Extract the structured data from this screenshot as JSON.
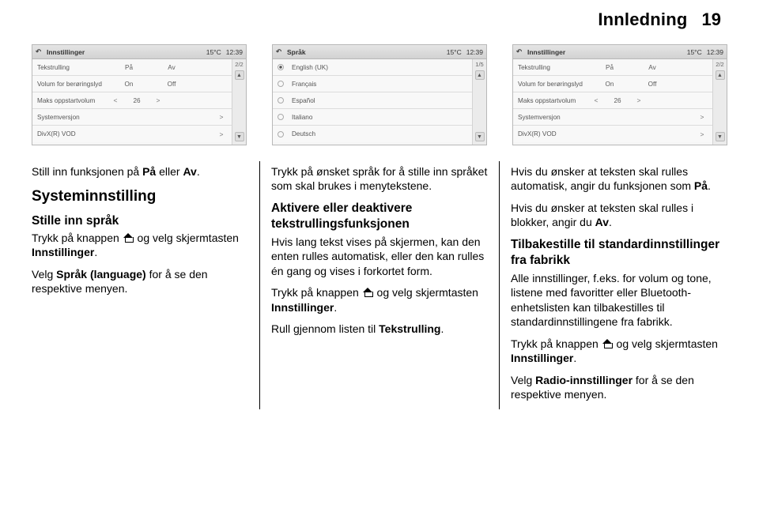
{
  "header": {
    "section": "Innledning",
    "page": "19"
  },
  "screens": {
    "settings": {
      "title": "Innstillinger",
      "temp": "15°C",
      "time": "12:39",
      "counter": "2/2",
      "rows": [
        {
          "label": "Tekstrulling",
          "opt1": "På",
          "opt2": "Av"
        },
        {
          "label": "Volum for berøringslyd",
          "opt1": "On",
          "opt2": "Off"
        },
        {
          "label": "Maks oppstartvolum",
          "left": "<",
          "val": "26",
          "right": ">"
        },
        {
          "label": "Systemversjon",
          "arrow": ">"
        },
        {
          "label": "DivX(R) VOD",
          "arrow": ">"
        }
      ]
    },
    "lang": {
      "title": "Språk",
      "temp": "15°C",
      "time": "12:39",
      "counter": "1/5",
      "rows": [
        {
          "label": "English (UK)",
          "selected": true
        },
        {
          "label": "Français"
        },
        {
          "label": "Español"
        },
        {
          "label": "Italiano"
        },
        {
          "label": "Deutsch"
        }
      ]
    }
  },
  "col1": {
    "p1a": "Still inn funksjonen på ",
    "p1b": "På",
    "p1c": " eller ",
    "p1d": "Av",
    "h1": "Systeminnstilling",
    "h2": "Stille inn språk",
    "p2a": "Trykk på knappen ",
    "p2b": " og velg skjermtasten ",
    "p2c": "Innstillinger",
    "p3a": "Velg ",
    "p3b": "Språk (language)",
    "p3c": " for å se den respektive menyen."
  },
  "col2": {
    "p1": "Trykk på ønsket språk for å stille inn språket som skal brukes i menytekstene.",
    "h2": "Aktivere eller deaktivere tekstrullingsfunksjonen",
    "p2": "Hvis lang tekst vises på skjermen, kan den enten rulles automatisk, eller den kan rulles én gang og vises i forkortet form.",
    "p3a": "Trykk på knappen ",
    "p3b": " og velg skjermtasten ",
    "p3c": "Innstillinger",
    "p4a": "Rull gjennom listen til ",
    "p4b": "Tekstrulling"
  },
  "col3": {
    "p1a": "Hvis du ønsker at teksten skal rulles automatisk, angir du funksjonen som ",
    "p1b": "På",
    "p2a": "Hvis du ønsker at teksten skal rulles i blokker, angir du ",
    "p2b": "Av",
    "h2": "Tilbakestille til standardinnstillinger fra fabrikk",
    "p3": "Alle innstillinger, f.eks. for volum og tone, listene med favoritter eller Bluetooth-enhetslisten kan tilbakestilles til standardinnstillingene fra fabrikk.",
    "p4a": "Trykk på knappen ",
    "p4b": " og velg skjermtasten ",
    "p4c": "Innstillinger",
    "p5a": "Velg ",
    "p5b": "Radio-innstillinger",
    "p5c": " for å se den respektive menyen."
  }
}
